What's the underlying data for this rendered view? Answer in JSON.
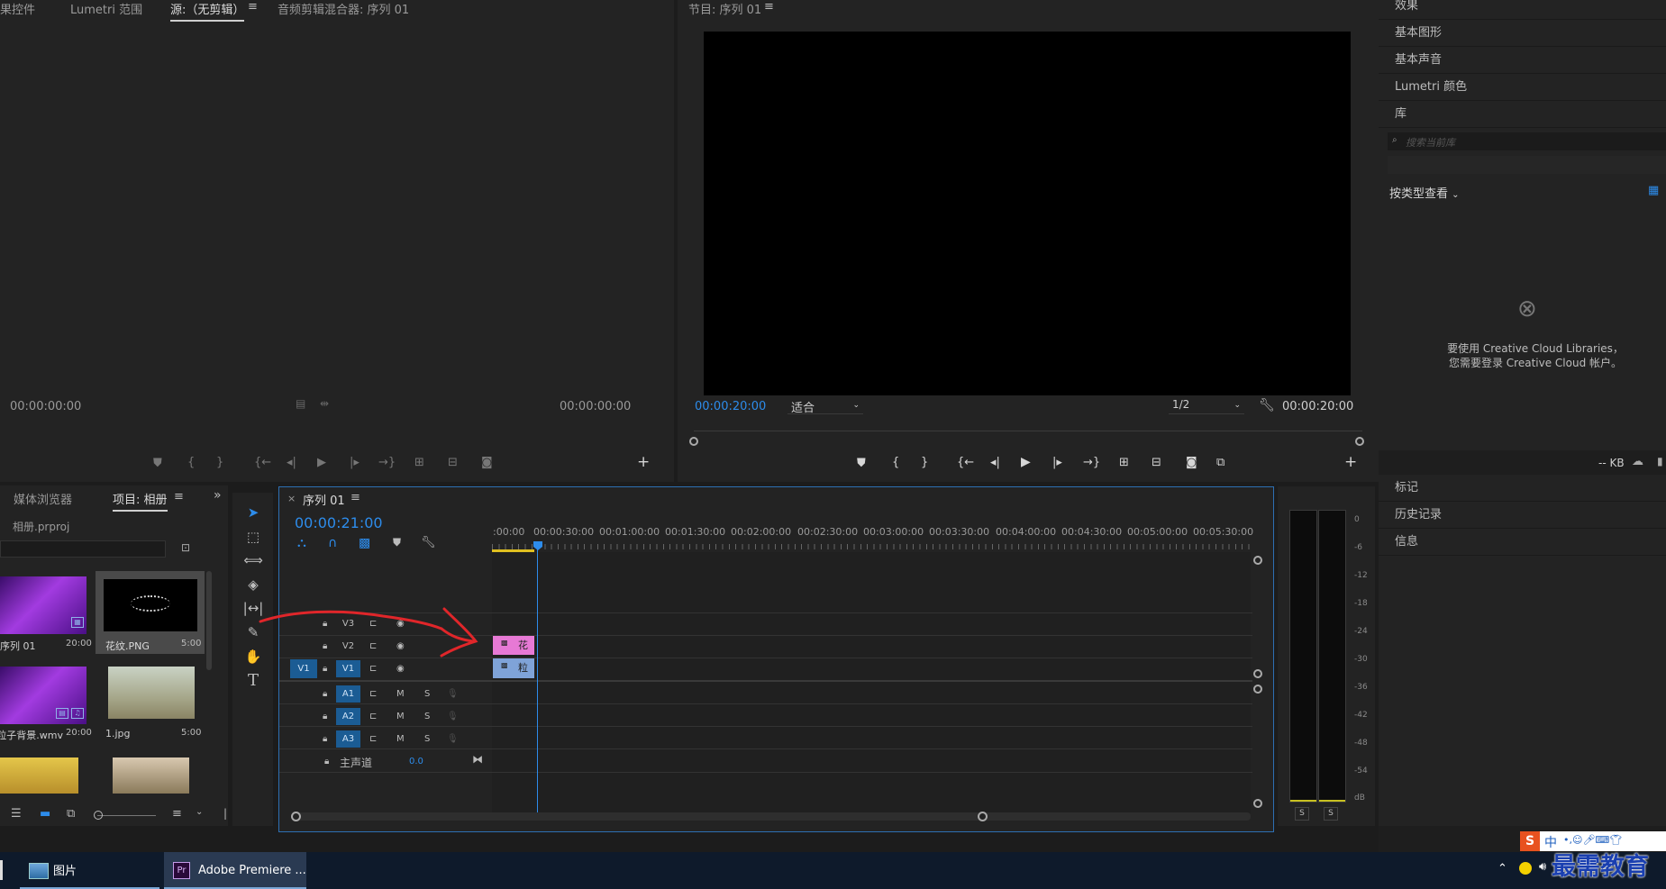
{
  "source_panel": {
    "tabs": [
      "果控件",
      "Lumetri 范围",
      "源:（无剪辑）",
      "音频剪辑混合器: 序列 01"
    ],
    "timecode_left": "00:00:00:00",
    "timecode_right": "00:00:00:00"
  },
  "program_panel": {
    "tab": "节目: 序列 01",
    "timecode_left": "00:00:20:00",
    "fit_label": "适合",
    "resolution": "1/2",
    "timecode_right": "00:00:20:00"
  },
  "right_panel": {
    "items": [
      "效果",
      "基本图形",
      "基本声音",
      "Lumetri 颜色",
      "库"
    ],
    "search_placeholder": "搜索当前库",
    "view_by_label": "按类型查看",
    "message": "要使用 Creative Cloud Libraries，您需要登录 Creative Cloud 帐户。",
    "size_label": "-- KB",
    "bottom_items": [
      "标记",
      "历史记录",
      "信息"
    ]
  },
  "project_panel": {
    "tabs": [
      "媒体浏览器",
      "项目: 相册"
    ],
    "project_file": "相册.prproj",
    "items": [
      {
        "name": "序列 01",
        "duration": "20:00"
      },
      {
        "name": "花纹.PNG",
        "duration": "5:00"
      },
      {
        "name": "粒子背景.wmv",
        "duration": "20:00"
      },
      {
        "name": "1.jpg",
        "duration": "5:00"
      }
    ]
  },
  "timeline": {
    "tab": "序列 01",
    "timecode": "00:00:21:00",
    "ruler": [
      ":00:00",
      "00:00:30:00",
      "00:01:00:00",
      "00:01:30:00",
      "00:02:00:00",
      "00:02:30:00",
      "00:03:00:00",
      "00:03:30:00",
      "00:04:00:00",
      "00:04:30:00",
      "00:05:00:00",
      "00:05:30:00"
    ],
    "video_tracks": [
      "V3",
      "V2",
      "V1"
    ],
    "audio_tracks": [
      "A1",
      "A2",
      "A3"
    ],
    "source_patch": "V1",
    "mute_label": "M",
    "solo_label": "S",
    "master_label": "主声道",
    "master_value": "0.0",
    "clip_v2": "花",
    "clip_v1": "粒"
  },
  "audio_meter": {
    "scale": [
      "0",
      "-6",
      "-12",
      "-18",
      "-24",
      "-30",
      "-36",
      "-42",
      "-48",
      "-54",
      "dB"
    ],
    "solo_buttons": [
      "S",
      "S"
    ]
  },
  "taskbar": {
    "items": [
      "图片",
      "Adobe Premiere ..."
    ],
    "watermark": "最需教育",
    "ime_label": "中"
  },
  "colors": {
    "accent": "#2d8ceb",
    "v2_clip": "#e779d5",
    "v1_clip": "#7fa3d8",
    "annotation": "#e0262a"
  }
}
